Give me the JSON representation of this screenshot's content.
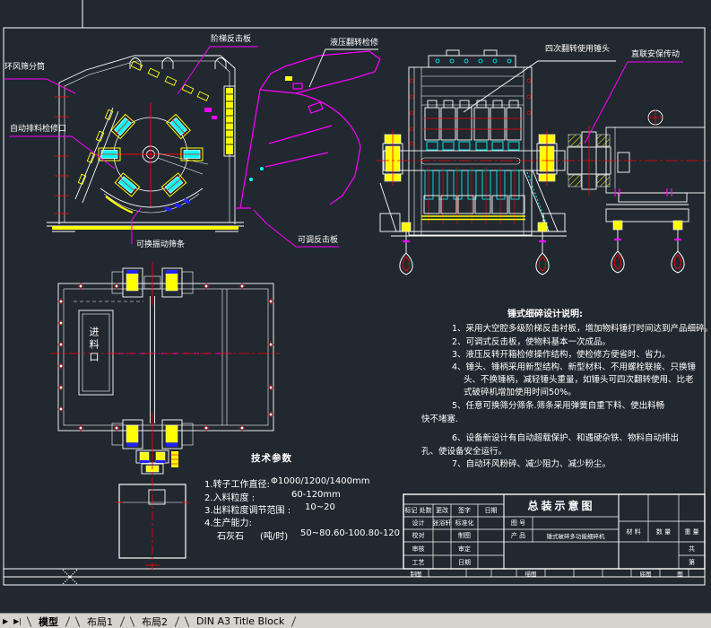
{
  "colors": {
    "background": "#212830",
    "line_white": "#ffffff",
    "accent_yellow": "#ffff00",
    "accent_cyan": "#00ffff",
    "accent_magenta": "#ff00ff",
    "accent_red": "#ff0000",
    "accent_blue": "#2222ff",
    "tabbar_gray": "#d6d3ce"
  },
  "callouts": {
    "stepped_impact_plate": "阶梯反击板",
    "hydraulic_overturn_service": "液压翻转检修",
    "air_ring_screen_cylinder": "环风筛分筒",
    "auto_discharge_service_port": "自动排料检修口",
    "replaceable_screen_bars": "可换振动筛条",
    "adjustable_impact_plate": "可调反击板",
    "hammer_four_turns": "四次翻转使用锤头",
    "direct_coupled_drive": "直联安保传动",
    "feed_inlet": "进料口"
  },
  "tech_params": {
    "title": "技术参数",
    "rows": [
      {
        "label": "1.转子工作直径:",
        "value": "Φ1000/1200/1400mm"
      },
      {
        "label": "2.入料粒度 :",
        "value": "60-120mm"
      },
      {
        "label": "3.出料粒度调节范围 :",
        "value": "10~20"
      },
      {
        "label": "4.生产能力:",
        "value": ""
      }
    ],
    "capacity": {
      "material": "石灰石",
      "unit": "(吨/时)",
      "value": "50~80.60-100.80-120"
    }
  },
  "design_notes": {
    "title": "锤式细碎设计说明:",
    "lines": [
      "1、采用大空腔多级阶梯反击衬板，增加物料锤打时间达到产品细碎。",
      "2、可调式反击板，使物料基本一次成品。",
      "3、液压反转开箱检修操作结构，使检修方便省时、省力。",
      "4、锤头、锤柄采用新型结构、新型材料、不用螺栓联接、只换锤",
      "头、不换锤柄，减轻锤头重量，如锤头可四次翻转使用、比老",
      "式破碎机增加使用时间50%。",
      "5、任意可换筛分筛条.筛条采用弹簧自重下料、使出料畅",
      "快不堵塞.",
      "6、设备新设计有自动超载保护、和遇硬杂铁、物料自动排出",
      "孔、使设备安全运行。",
      "7、自动环风粉碎、减少阻力、减少粉尘。"
    ]
  },
  "title_block": {
    "main_title": "总装示意图",
    "header": [
      "标记 处数",
      "更改",
      "签字",
      "日期"
    ],
    "left_rows": [
      {
        "c1": "设计",
        "c2": "张浴轩",
        "c3": "标准化",
        "c4": ""
      },
      {
        "c1": "校对",
        "c2": "",
        "c3": "制图",
        "c4": ""
      },
      {
        "c1": "审核",
        "c2": "",
        "c3": "审定",
        "c4": ""
      },
      {
        "c1": "工艺",
        "c2": "",
        "c3": "日期",
        "c4": ""
      }
    ],
    "drawing_no_label": "图 号",
    "product_label": "产 品",
    "product_name": "锤式破碎多功能细碎机",
    "material_label": "材 料",
    "quantity_label": "数 量",
    "weight_label": "重 量",
    "total_label": "共",
    "sheet_label": "第",
    "strip": [
      "制图",
      "描图",
      "底图",
      "图"
    ]
  },
  "tabs": {
    "nav": [
      "▶",
      "▶|"
    ],
    "items": [
      {
        "label": "模型",
        "active": true
      },
      {
        "label": "布局1",
        "active": false
      },
      {
        "label": "布局2",
        "active": false
      },
      {
        "label": "DIN A3 Title Block",
        "active": false
      }
    ]
  }
}
